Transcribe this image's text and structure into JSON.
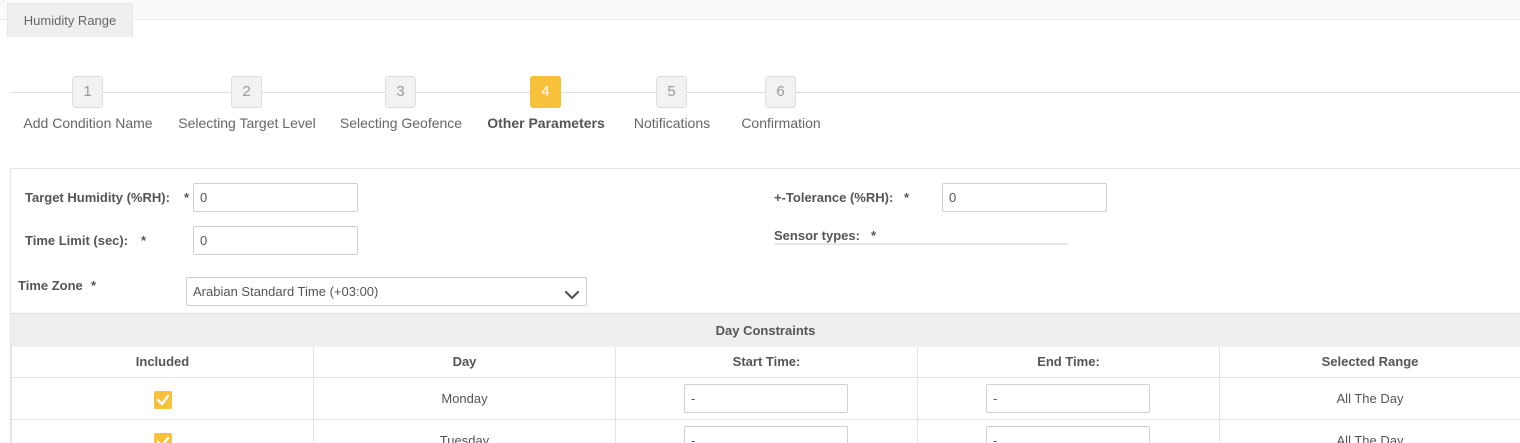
{
  "tab": {
    "label": "Humidity Range"
  },
  "wizard": {
    "steps": [
      {
        "number": "1",
        "label": "Add Condition Name"
      },
      {
        "number": "2",
        "label": "Selecting Target Level"
      },
      {
        "number": "3",
        "label": "Selecting Geofence"
      },
      {
        "number": "4",
        "label": "Other Parameters"
      },
      {
        "number": "5",
        "label": "Notifications"
      },
      {
        "number": "6",
        "label": "Confirmation"
      }
    ],
    "active_step": 4,
    "active_color": "#f7c13b"
  },
  "form": {
    "target_humidity": {
      "label": "Target Humidity (%RH):",
      "required": "*",
      "value": "0"
    },
    "tolerance": {
      "label": "+-Tolerance (%RH):",
      "required": "*",
      "value": "0"
    },
    "time_limit": {
      "label": "Time Limit (sec):",
      "required": "*",
      "value": "0"
    },
    "sensor_types": {
      "label": "Sensor types:",
      "required": "*"
    },
    "time_zone": {
      "label": "Time Zone",
      "required": "*",
      "value": "Arabian Standard Time (+03:00)",
      "icon": "chevron-down-icon"
    }
  },
  "day_constraints": {
    "title": "Day Constraints",
    "columns": [
      "Included",
      "Day",
      "Start Time:",
      "End Time:",
      "Selected Range"
    ],
    "rows": [
      {
        "included": true,
        "day": "Monday",
        "start": "-",
        "end": "-",
        "range": "All The Day"
      },
      {
        "included": true,
        "day": "Tuesday",
        "start": "-",
        "end": "-",
        "range": "All The Day"
      }
    ]
  }
}
